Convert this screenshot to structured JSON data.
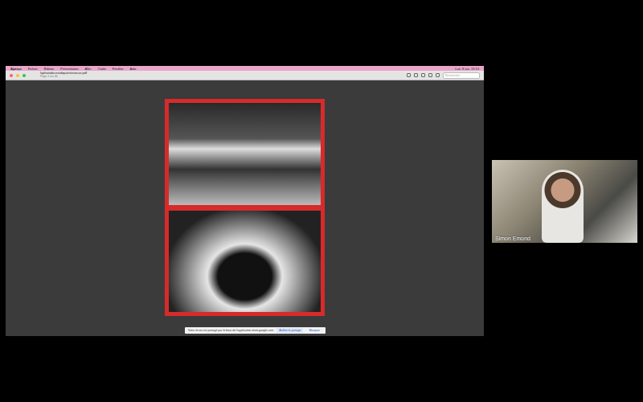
{
  "shared_screen": {
    "app_menu": [
      "Aperçu",
      "Fichier",
      "Édition",
      "Présentation",
      "Aller",
      "Outils",
      "Fenêtre",
      "Aide"
    ],
    "clock": "Lun. 8 avr. 19:13",
    "document": {
      "title": "laphotodecestdiquiesteviecor.pdf",
      "subtitle": "Page 1 sur 40"
    },
    "search": {
      "placeholder": "Rechercher"
    }
  },
  "share_banner": {
    "message": "Votre écran est partagé par le biais de l'application meet.google.com",
    "buttons": [
      "Arrêter le partage",
      "Masquer"
    ]
  },
  "participant": {
    "name": "Simon Emond"
  }
}
